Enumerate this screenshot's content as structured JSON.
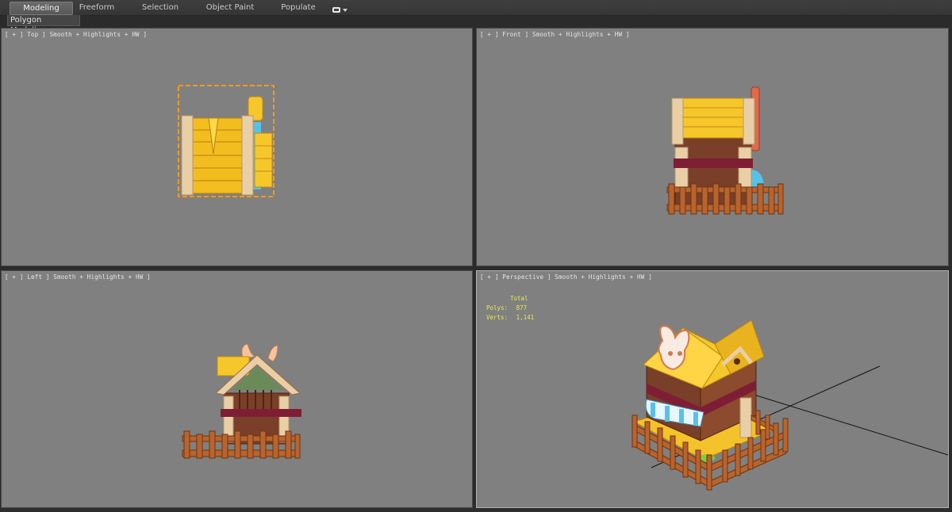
{
  "ribbon": {
    "tabs": [
      {
        "label": "Modeling",
        "active": true
      },
      {
        "label": "Freeform",
        "active": false
      },
      {
        "label": "Selection",
        "active": false
      },
      {
        "label": "Object Paint",
        "active": false
      },
      {
        "label": "Populate",
        "active": false
      }
    ],
    "dropdown_icon": "ribbon-options-icon",
    "panel_label": "Polygon Modeling"
  },
  "viewports": {
    "top": {
      "label": "[ + ] Top ] Smooth + Highlights + HW ]"
    },
    "front": {
      "label": "[ + ] Front ] Smooth + Highlights + HW ]"
    },
    "left": {
      "label": "[ + ] Left ] Smooth + Highlights + HW ]"
    },
    "perspective": {
      "label": "[ + ] Perspective ] Smooth + Highlights + HW ]",
      "stats": {
        "header": "Total",
        "polys_label": "Polys:",
        "polys_value": "877",
        "verts_label": "Verts:",
        "verts_value": "1,141"
      }
    }
  },
  "colors": {
    "viewport_bg": "#808080",
    "selection": "#f09a20",
    "stats_text": "#e8e85a",
    "roof_yellow": "#f6c72a",
    "wood_brown": "#7a3f28",
    "trim_cream": "#e9cfa5",
    "band_maroon": "#7e1e35",
    "awning_blue": "#58c1e8"
  }
}
